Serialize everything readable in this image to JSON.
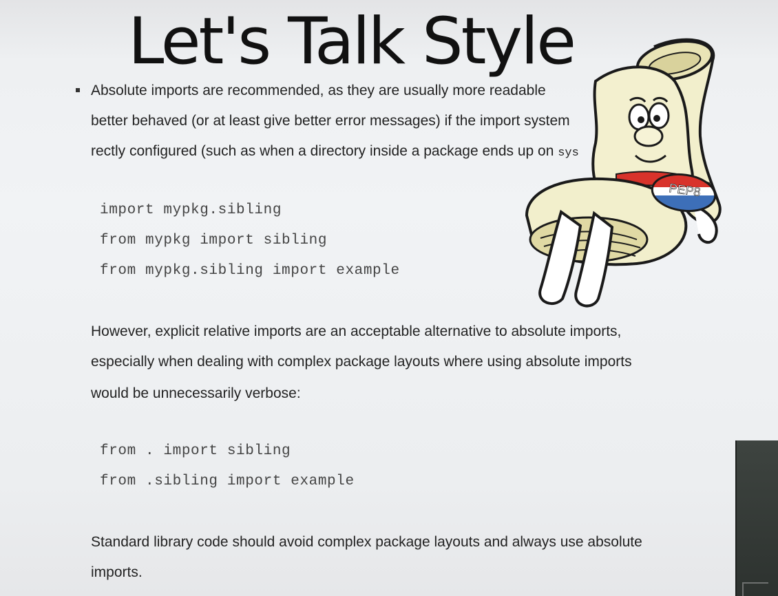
{
  "slide": {
    "title": "Let's Talk Style",
    "bullet_lines": [
      "Absolute imports are recommended, as they are usually more readable",
      "better behaved (or at least give better error messages) if the import system",
      "rectly configured (such as when a directory inside a package ends up on"
    ],
    "bullet_code_fragment": "sys",
    "absolute_examples": [
      "import mypkg.sibling",
      "from mypkg import sibling",
      "from mypkg.sibling import example"
    ],
    "relative_paragraph": [
      "However, explicit relative imports are an acceptable alternative to absolute imports,",
      "especially when dealing with complex package layouts where using absolute imports",
      "would be unnecessarily verbose:"
    ],
    "relative_examples": [
      "from . import sibling",
      "from .sibling import example"
    ],
    "stdlib_paragraph": [
      "Standard library code should avoid complex package layouts and always use absolute",
      "imports."
    ]
  },
  "mascot": {
    "icon": "pep8-scroll-mascot-icon",
    "badge_text": "PEP8",
    "colors": {
      "paper": "#f2efcc",
      "outline": "#1a1a1a",
      "badge_red": "#d8332b",
      "badge_blue": "#3d6fb8"
    }
  },
  "colors": {
    "background": "#eef0f2",
    "text": "#222222",
    "code_text": "#444444",
    "side_panel": "#363b38"
  }
}
